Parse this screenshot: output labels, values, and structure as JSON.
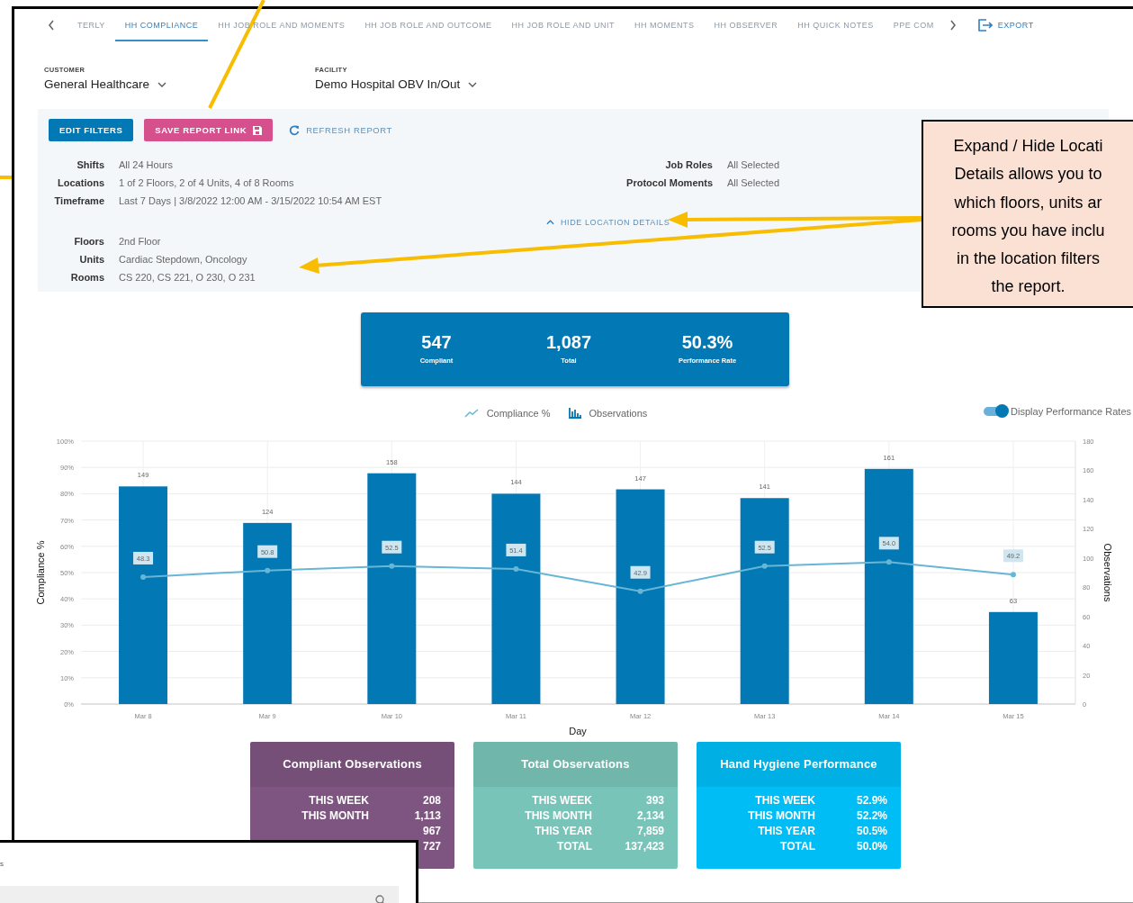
{
  "tabs": [
    {
      "label": "TERLY",
      "selected": false
    },
    {
      "label": "HH COMPLIANCE",
      "selected": true
    },
    {
      "label": "HH JOB ROLE AND MOMENTS",
      "selected": false
    },
    {
      "label": "HH JOB ROLE AND OUTCOME",
      "selected": false
    },
    {
      "label": "HH JOB ROLE AND UNIT",
      "selected": false
    },
    {
      "label": "HH MOMENTS",
      "selected": false
    },
    {
      "label": "HH OBSERVER",
      "selected": false
    },
    {
      "label": "HH QUICK NOTES",
      "selected": false
    },
    {
      "label": "PPE COM",
      "selected": false
    }
  ],
  "export": {
    "label": "EXPORT"
  },
  "selectors": [
    {
      "label": "CUSTOMER",
      "value": "General Healthcare"
    },
    {
      "label": "FACILITY",
      "value": "Demo Hospital OBV In/Out"
    }
  ],
  "filters": {
    "buttons": [
      {
        "label": "EDIT FILTERS",
        "kind": "primary"
      },
      {
        "label": "SAVE REPORT LINK",
        "kind": "save"
      },
      {
        "label": "REFRESH REPORT",
        "kind": "refresh"
      }
    ],
    "left": [
      {
        "label": "Shifts",
        "value": "All 24 Hours"
      },
      {
        "label": "Locations",
        "value": "1 of 2 Floors, 2 of 4 Units, 4 of 8 Rooms"
      },
      {
        "label": "Timeframe",
        "value": "Last 7 Days | 3/8/2022 12:00 AM - 3/15/2022 10:54 AM EST"
      }
    ],
    "right": [
      {
        "label": "Job Roles",
        "value": "All Selected"
      },
      {
        "label": "Protocol Moments",
        "value": "All Selected"
      }
    ],
    "location_toggle": {
      "label": "HIDE LOCATION DETAILS",
      "expanded": true
    },
    "location_details": [
      {
        "label": "Floors",
        "value": "2nd Floor"
      },
      {
        "label": "Units",
        "value": "Cardiac Stepdown, Oncology"
      },
      {
        "label": "Rooms",
        "value": "CS 220, CS 221, O 230, O 231"
      }
    ]
  },
  "kpis": [
    {
      "value": "547",
      "label": "Compliant"
    },
    {
      "value": "1,087",
      "label": "Total"
    },
    {
      "value": "50.3%",
      "label": "Performance Rate"
    }
  ],
  "performance_toggle": {
    "label": "Display Performance Rates",
    "on": true
  },
  "chart_data": {
    "type": "bar",
    "xlabel": "Day",
    "ylabel": "Compliance %",
    "y2label": "Observations",
    "categories": [
      "Mar 8",
      "Mar 9",
      "Mar 10",
      "Mar 11",
      "Mar 12",
      "Mar 13",
      "Mar 14",
      "Mar 15"
    ],
    "grid": true,
    "legend": "top",
    "series": [
      {
        "name": "Compliance %",
        "color": "#67b6d6",
        "type": "line",
        "marker": true,
        "values": [
          48.3,
          50.8,
          52.5,
          51.4,
          42.9,
          52.5,
          54.0,
          49.2
        ],
        "value_labels": [
          "48.3",
          "50.8",
          "52.5",
          "51.4",
          "42.9",
          "52.5",
          "54.0",
          "49.2"
        ]
      },
      {
        "name": "Observations",
        "color": "#0278b4",
        "axis": "y2",
        "values": [
          149,
          124,
          158,
          144,
          147,
          141,
          161,
          63
        ],
        "value_labels": [
          "149",
          "124",
          "158",
          "144",
          "147",
          "141",
          "161",
          "63"
        ]
      }
    ],
    "ylim": [
      0,
      100
    ],
    "y2lim": [
      0,
      180
    ],
    "yticks": [
      {
        "value": 0,
        "label": "0%"
      },
      {
        "value": 10,
        "label": "10%"
      },
      {
        "value": 20,
        "label": "20%"
      },
      {
        "value": 30,
        "label": "30%"
      },
      {
        "value": 40,
        "label": "40%"
      },
      {
        "value": 50,
        "label": "50%"
      },
      {
        "value": 60,
        "label": "60%"
      },
      {
        "value": 70,
        "label": "70%"
      },
      {
        "value": 80,
        "label": "80%"
      },
      {
        "value": 90,
        "label": "90%"
      },
      {
        "value": 100,
        "label": "100%"
      }
    ],
    "y2ticks": [
      0,
      20,
      40,
      60,
      80,
      100,
      120,
      140,
      160,
      180
    ]
  },
  "cards": [
    {
      "title": "Compliant Observations",
      "color": "#7e5581",
      "rows": [
        {
          "label": "THIS WEEK",
          "value": "208"
        },
        {
          "label": "THIS MONTH",
          "value": "1,113"
        },
        {
          "value": "967"
        },
        {
          "value": "727"
        }
      ]
    },
    {
      "title": "Total Observations",
      "color": "#79c4b9",
      "rows": [
        {
          "label": "THIS WEEK",
          "value": "393"
        },
        {
          "label": "THIS MONTH",
          "value": "2,134"
        },
        {
          "label": "THIS YEAR",
          "value": "7,859"
        },
        {
          "label": "TOTAL",
          "value": "137,423"
        }
      ]
    },
    {
      "title": "Hand Hygiene Performance",
      "color": "#00bdf5",
      "rows": [
        {
          "label": "THIS WEEK",
          "value": "52.9%"
        },
        {
          "label": "THIS MONTH",
          "value": "52.2%"
        },
        {
          "label": "THIS YEAR",
          "value": "50.5%"
        },
        {
          "label": "TOTAL",
          "value": "50.0%"
        }
      ]
    }
  ],
  "callout": {
    "lines": [
      "Expand / Hide Locati",
      "Details allows you to",
      "which floors, units ar",
      "rooms you have inclu",
      "in the location filters",
      "the report."
    ]
  },
  "overlay_window": {
    "title": "s"
  }
}
